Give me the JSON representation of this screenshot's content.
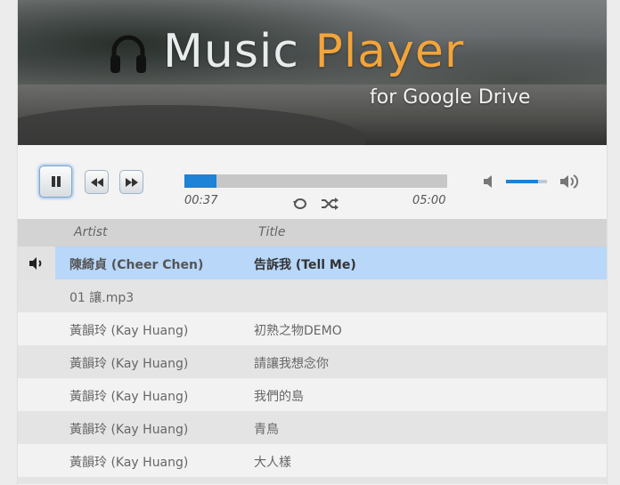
{
  "banner": {
    "title_part1": "Music ",
    "title_part2": "Player",
    "subtitle": "for Google Drive",
    "accent_color": "#f3a43a",
    "icon": "headphones-icon"
  },
  "player": {
    "elapsed": "00:37",
    "duration": "05:00",
    "progress_fraction": 0.123,
    "volume_fraction": 0.78,
    "progress_color": "#1e82d6",
    "buttons": [
      "pause-icon",
      "rewind-icon",
      "fast-forward-icon",
      "repeat-icon",
      "shuffle-icon",
      "volume-low-icon",
      "volume-high-icon"
    ]
  },
  "table": {
    "headers": {
      "artist": "Artist",
      "title": "Title"
    },
    "rows": [
      {
        "artist": "陳綺貞 (Cheer Chen)",
        "title": "告訴我 (Tell Me)",
        "playing": true
      },
      {
        "artist": "01 讓.mp3",
        "title": ""
      },
      {
        "artist": "黃韻玲 (Kay Huang)",
        "title": "初熟之物DEMO"
      },
      {
        "artist": "黃韻玲 (Kay Huang)",
        "title": "請讓我想念你"
      },
      {
        "artist": "黃韻玲 (Kay Huang)",
        "title": "我們的島"
      },
      {
        "artist": "黃韻玲 (Kay Huang)",
        "title": "青鳥"
      },
      {
        "artist": "黃韻玲 (Kay Huang)",
        "title": "大人樣"
      }
    ],
    "playing_row_color": "#b8d7f9"
  }
}
